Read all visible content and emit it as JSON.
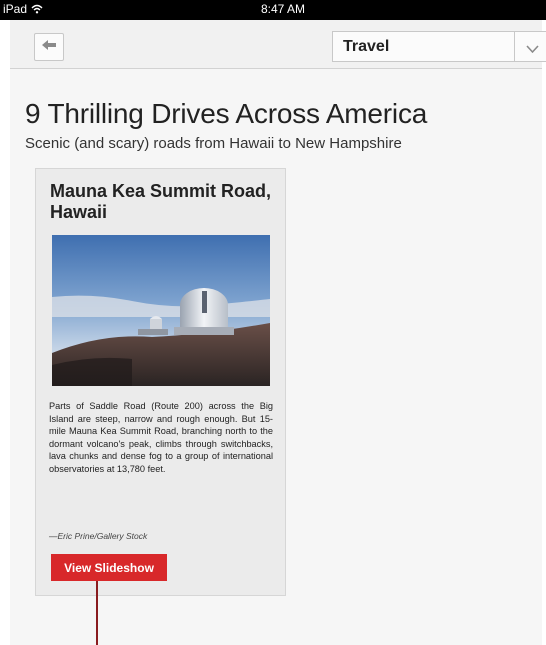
{
  "status_bar": {
    "device": "iPad",
    "time": "8:47 AM"
  },
  "toolbar": {
    "section_value": "Travel"
  },
  "article": {
    "title": "9 Thrilling Drives Across America",
    "subtitle": "Scenic (and scary) roads from Hawaii to New Hampshire"
  },
  "card": {
    "title": "Mauna Kea Summit Road, Hawaii",
    "body": "Parts of Saddle Road (Route 200) across the Big Island are steep, narrow and rough enough. But 15-mile Mauna Kea Summit Road, branching north to the dormant volcano's peak, climbs through switchbacks, lava chunks and dense fog to a group of international observatories at 13,780 feet.",
    "credit": "—Eric Prine/Gallery Stock",
    "button_label": "View Slideshow"
  },
  "colors": {
    "accent": "#d8282a",
    "callout": "#8a1c1f"
  },
  "icons": [
    "wifi-icon",
    "back-arrow-icon",
    "chevron-down-icon"
  ]
}
